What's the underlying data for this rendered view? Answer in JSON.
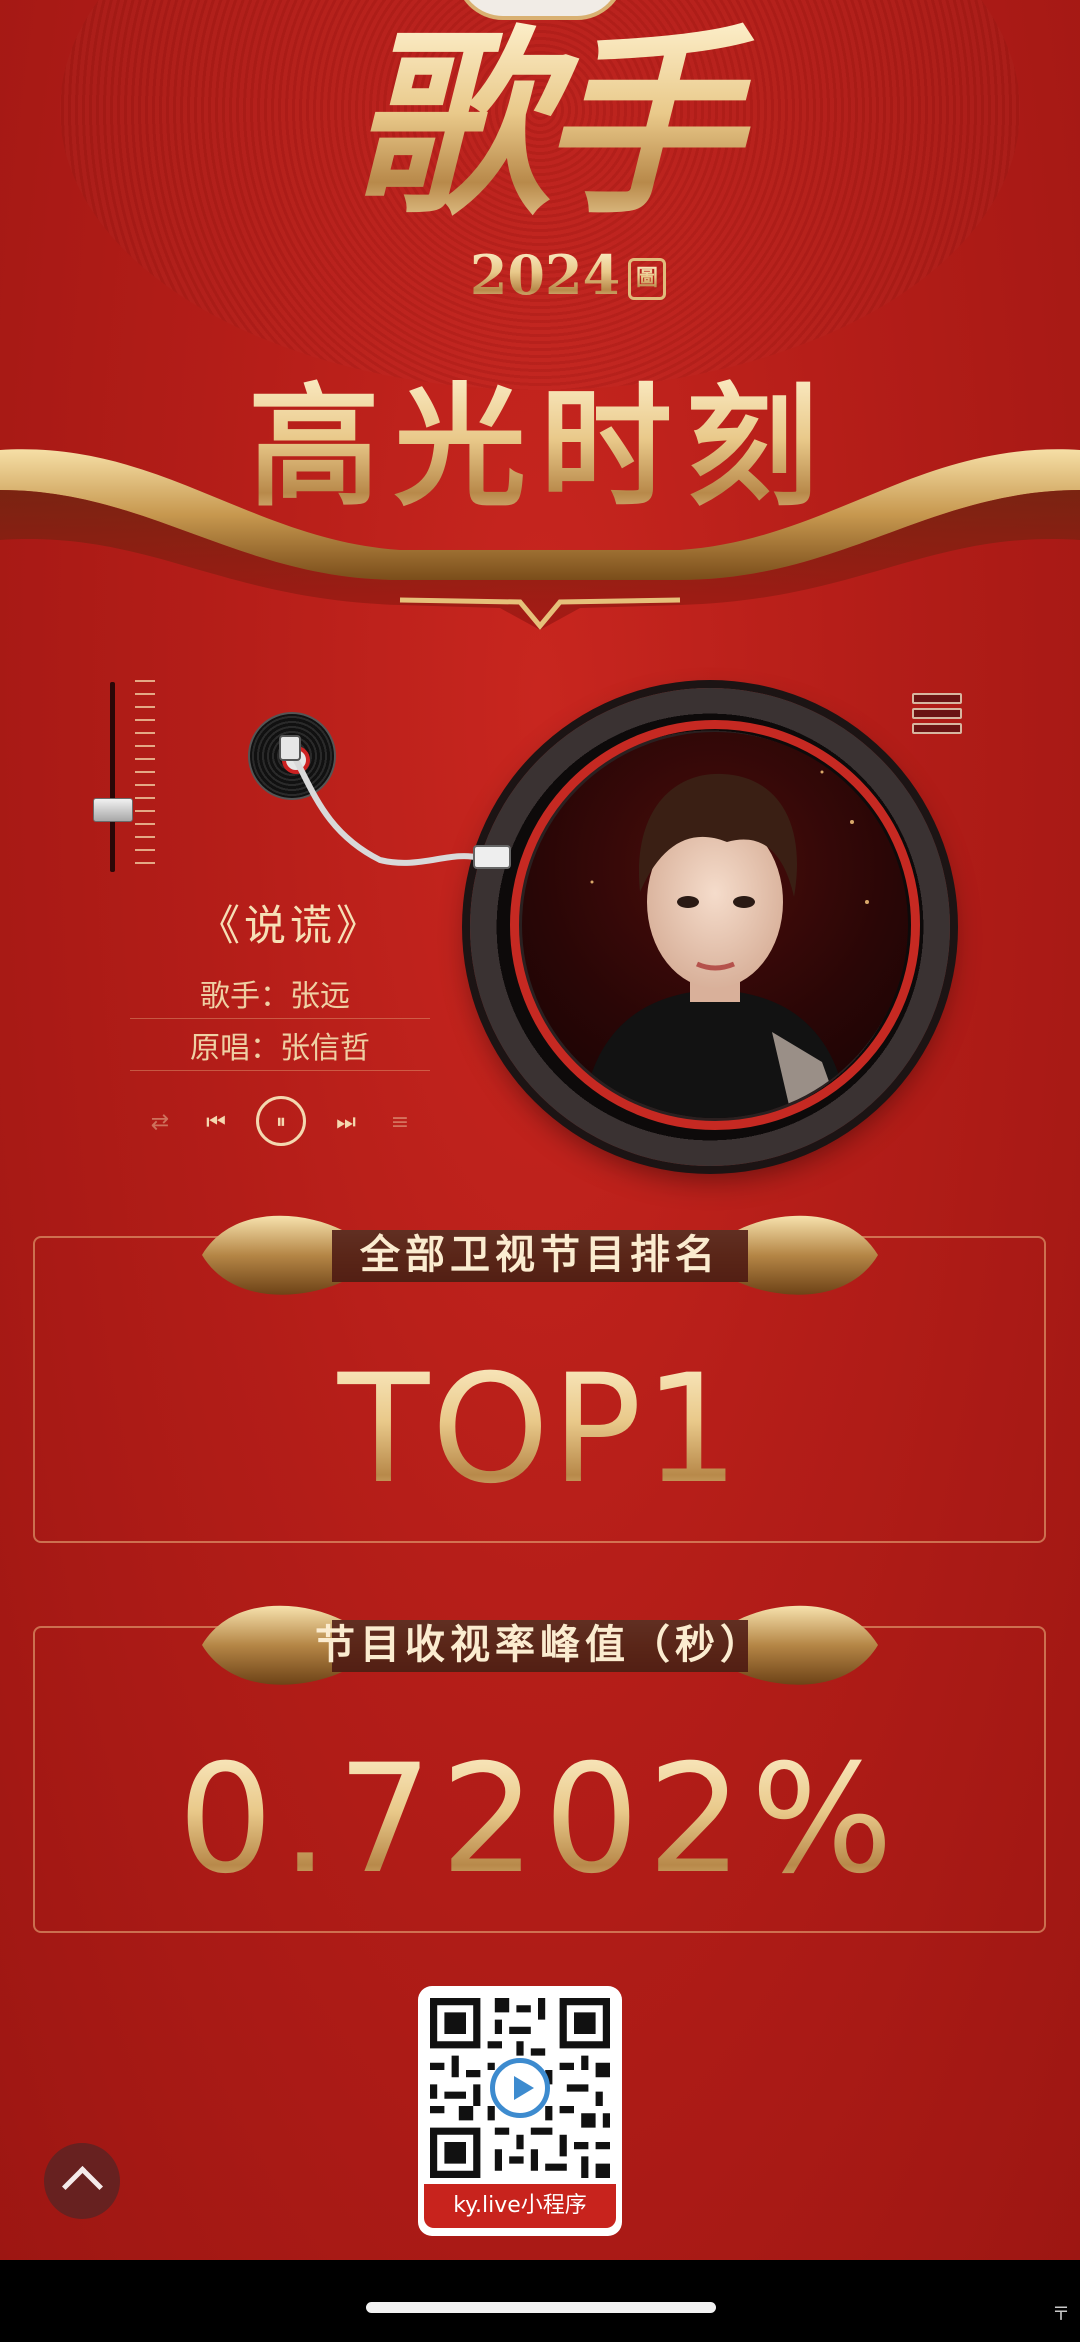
{
  "header": {
    "logo_text": "歌手",
    "logo_year": "2024",
    "logo_seal": "圖",
    "title": "高光时刻"
  },
  "player": {
    "song_title": "《说谎》",
    "singer": "歌手：张远",
    "original": "原唱：张信哲",
    "controls": {
      "repeat": "⇄",
      "prev": "⏮",
      "pause": "⏸",
      "next": "⏭",
      "playlist": "≡"
    },
    "icons": [
      "slider-icon",
      "menu-icon",
      "vinyl-record-icon",
      "tonearm-icon"
    ]
  },
  "stats": [
    {
      "label": "全部卫视节目排名",
      "value": "TOP1"
    },
    {
      "label": "节目收视率峰值（秒）",
      "value": "0.7202%"
    }
  ],
  "qr": {
    "label": "ky.live小程序"
  },
  "system": {
    "corner_mark": "〒"
  },
  "colors": {
    "background": "#b31d18",
    "gold": "#e9c98a",
    "qr_label_bg": "#c8231d"
  }
}
